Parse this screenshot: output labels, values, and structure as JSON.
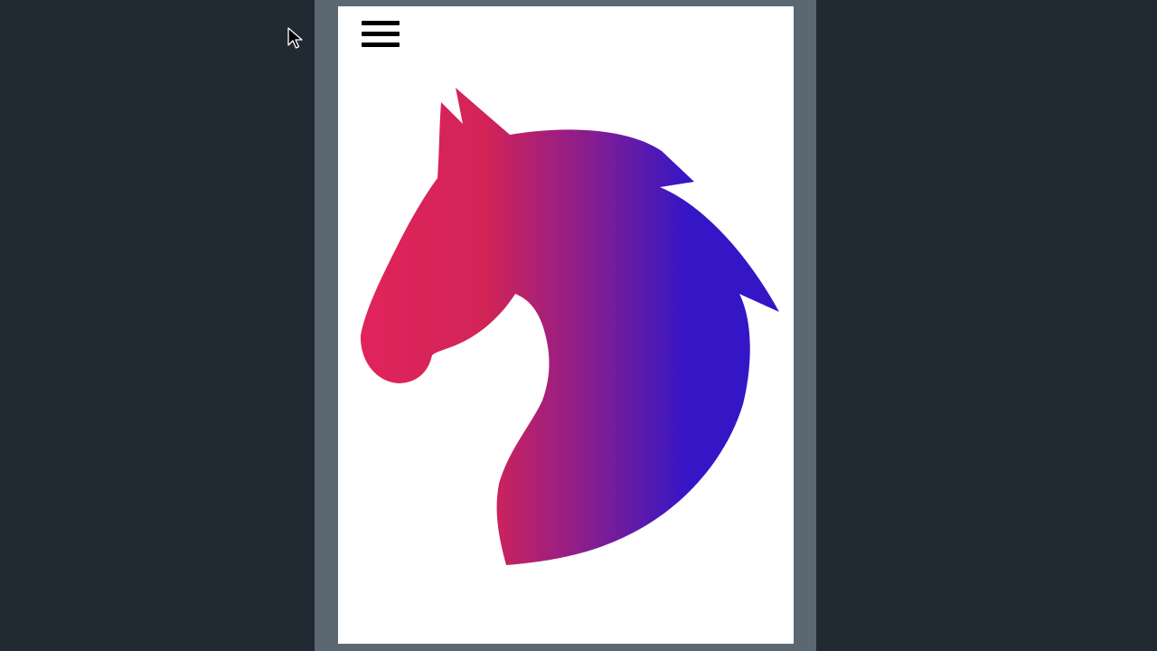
{
  "app": {
    "background_color": "#212a33",
    "frame_color": "#5b6872",
    "screen_color": "#ffffff"
  },
  "header": {
    "menu_icon": "hamburger-menu-icon"
  },
  "logo": {
    "icon": "horse-head-icon",
    "gradient": {
      "start_color": "#e0245a",
      "end_color": "#3516c6"
    }
  },
  "cursor": {
    "icon": "mouse-pointer-icon"
  }
}
